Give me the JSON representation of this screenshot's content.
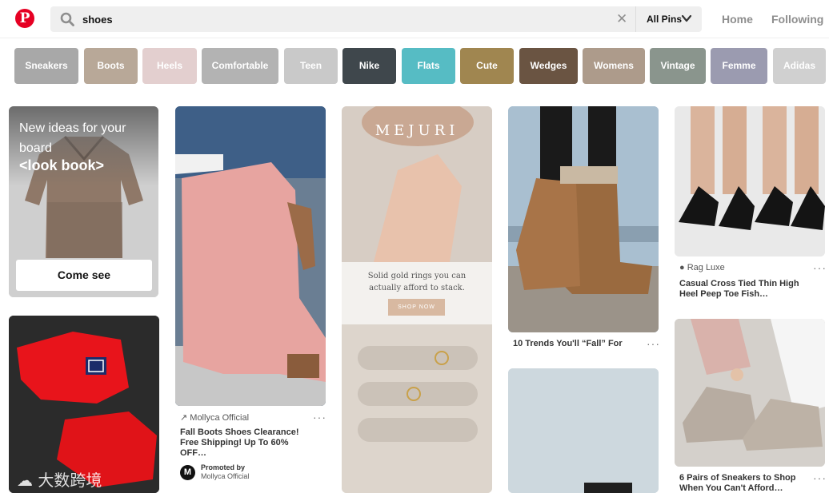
{
  "search": {
    "query": "shoes",
    "filter_label": "All Pins"
  },
  "nav": {
    "home": "Home",
    "following": "Following"
  },
  "guides": [
    {
      "label": "Sneakers",
      "color": "#a8a8a8"
    },
    {
      "label": "Boots",
      "color": "#b8a898"
    },
    {
      "label": "Heels",
      "color": "#e3cfcf"
    },
    {
      "label": "Comfortable",
      "color": "#b3b3b3"
    },
    {
      "label": "Teen",
      "color": "#c9c9c9"
    },
    {
      "label": "Nike",
      "color": "#3f474c"
    },
    {
      "label": "Flats",
      "color": "#56bcc4"
    },
    {
      "label": "Cute",
      "color": "#a08650"
    },
    {
      "label": "Wedges",
      "color": "#6a5442"
    },
    {
      "label": "Womens",
      "color": "#ad9b8b"
    },
    {
      "label": "Vintage",
      "color": "#8a958d"
    },
    {
      "label": "Femme",
      "color": "#9b9bb0"
    },
    {
      "label": "Adidas",
      "color": "#d0d0d0"
    }
  ],
  "board_card": {
    "heading": "New ideas for your board",
    "board_name": "<look book>",
    "cta": "Come see"
  },
  "pins": {
    "mollyca": {
      "source": "Mollyca Official",
      "title": "Fall Boots Shoes Clearance! Free Shipping! Up To 60% OFF…",
      "promoted": "Promoted by",
      "promoter": "Mollyca Official",
      "avatar_letter": "M"
    },
    "mejuri": {
      "brand": "MEJURI",
      "tagline": "Solid gold rings you can actually afford to stack.",
      "cta": "SHOP NOW"
    },
    "boots": {
      "title": "10 Trends You'll “Fall” For"
    },
    "ragluxe": {
      "source": "Rag Luxe",
      "title": "Casual Cross Tied Thin High Heel Peep Toe Fish…"
    },
    "sneakers": {
      "title": "6 Pairs of Sneakers to Shop When You Can't Afford…"
    },
    "fila": {
      "watermark": "大数跨境"
    }
  },
  "colors": {
    "brand_red": "#e60023",
    "search_bg": "#efefef"
  }
}
